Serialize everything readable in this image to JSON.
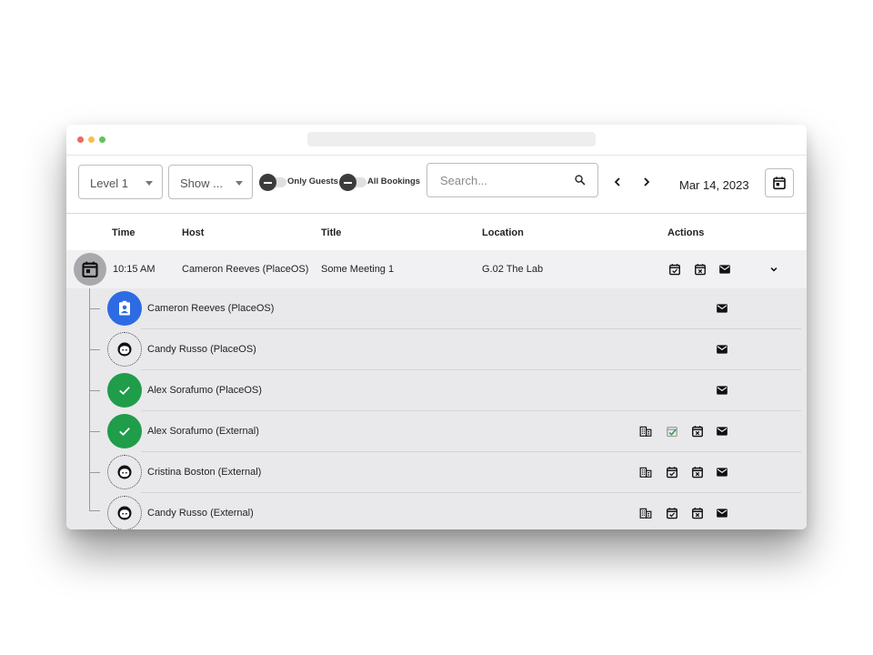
{
  "window": {
    "dot_colors": [
      "#ed6a5e",
      "#f5bf4f",
      "#61c554"
    ]
  },
  "toolbar": {
    "level_select": {
      "value": "Level 1"
    },
    "show_select": {
      "value": "Show ..."
    },
    "toggle_guests": {
      "label": "Only Guests",
      "on": false
    },
    "toggle_bookings": {
      "label": "All Bookings",
      "on": false
    },
    "search": {
      "placeholder": "Search...",
      "value": ""
    },
    "date": "Mar 14, 2023"
  },
  "table": {
    "headers": {
      "time": "Time",
      "host": "Host",
      "title": "Title",
      "location": "Location",
      "actions": "Actions"
    },
    "row": {
      "time": "10:15 AM",
      "host": "Cameron Reeves (PlaceOS)",
      "title": "Some Meeting 1",
      "location": "G.02 The Lab",
      "actions": [
        "checkin-icon",
        "decline-icon",
        "email-icon"
      ],
      "expanded": true
    },
    "guests": [
      {
        "name": "Cameron Reeves (PlaceOS)",
        "avatar": "host-badge-icon",
        "actions": [
          "email-icon"
        ]
      },
      {
        "name": "Candy Russo (PlaceOS)",
        "avatar": "face-icon",
        "actions": [
          "email-icon"
        ]
      },
      {
        "name": "Alex Sorafumo (PlaceOS)",
        "avatar": "checked-in-icon",
        "actions": [
          "email-icon"
        ]
      },
      {
        "name": "Alex Sorafumo (External)",
        "avatar": "checked-in-icon",
        "actions": [
          "building-icon",
          "checkin-icon",
          "decline-icon",
          "email-icon"
        ],
        "checkin_done": true
      },
      {
        "name": "Cristina Boston (External)",
        "avatar": "face-icon",
        "actions": [
          "building-icon",
          "checkin-icon",
          "decline-icon",
          "email-icon"
        ]
      },
      {
        "name": "Candy Russo (External)",
        "avatar": "face-icon",
        "actions": [
          "building-icon",
          "checkin-icon",
          "decline-icon",
          "email-icon"
        ]
      }
    ]
  },
  "colors": {
    "host_avatar": "#2d6be4",
    "checked_in": "#1f9d4a",
    "row_bg": "#f1f1f3",
    "guest_bg": "#e9e9eb"
  }
}
